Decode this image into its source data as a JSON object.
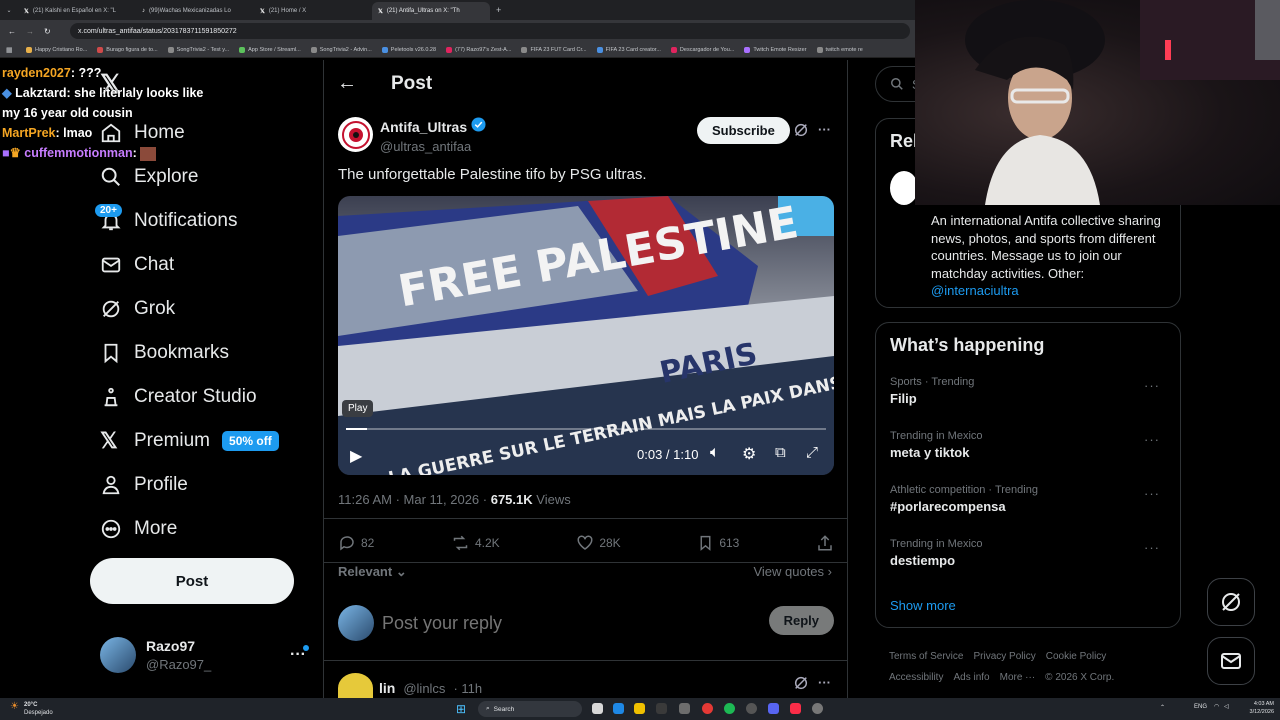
{
  "browser": {
    "tabs": [
      {
        "label": "(21) Kalshi en Español en X: \"L"
      },
      {
        "label": "(99)Wachas Mexicanizadas Lo"
      },
      {
        "label": "(21) Home / X"
      },
      {
        "label": "(21) Antifa_Ultras on X: \"Th"
      }
    ],
    "url": "x.com/ultras_antifaa/status/2031783711591850272",
    "bookmarks": [
      "Happy Cristiano Ro...",
      "Burago figura de to...",
      "SongTrivia2 - Test y...",
      "App Store / Streaml...",
      "SongTrivia2 - Advin...",
      "Peletools v26.0.28",
      "(77) Razo97's Zest-A...",
      "FIFA 23 FUT Card Cr...",
      "FIFA 23 Card creator...",
      "Descargador de You...",
      "Twitch Emote Resizer",
      "twitch emote re"
    ]
  },
  "chat": [
    {
      "user": "rayden2027",
      "msg": ": ???"
    },
    {
      "user": "Lakztard",
      "msg": ": she literlaly looks like my 16 year old cousin"
    },
    {
      "user": "MartPrek",
      "msg": ": lmao"
    },
    {
      "user": "cuffemmotionman",
      "msg": ":"
    }
  ],
  "nav": {
    "items": [
      {
        "label": "Home"
      },
      {
        "label": "Explore"
      },
      {
        "label": "Notifications",
        "badge": "20+"
      },
      {
        "label": "Chat"
      },
      {
        "label": "Grok"
      },
      {
        "label": "Bookmarks"
      },
      {
        "label": "Creator Studio"
      },
      {
        "label": "Premium",
        "promo": "50% off"
      },
      {
        "label": "Profile"
      },
      {
        "label": "More"
      }
    ],
    "post_button": "Post",
    "account": {
      "name": "Razo97",
      "handle": "@Razo97_"
    }
  },
  "post": {
    "header": "Post",
    "author": {
      "name": "Antifa_Ultras",
      "handle": "@ultras_antifaa"
    },
    "subscribe": "Subscribe",
    "text": "The unforgettable Palestine tifo by PSG ultras.",
    "video": {
      "tooltip": "Play",
      "time": "0:03 / 1:10",
      "progress": 0.043,
      "banner_top": "FREE PALESTINE",
      "banner_mid": "LA GUERRE SUR LE TERRAIN MAIS LA PAIX DANS LE MONDE",
      "banner_club": "PARIS"
    },
    "timestamp": "11:26 AM · Mar 11, 2026 · ",
    "views_count": "675.1K",
    "views_label": "Views",
    "stats": {
      "replies": "82",
      "reposts": "4.2K",
      "likes": "28K",
      "bookmarks": "613"
    },
    "sort": "Relevant",
    "view_quotes": "View quotes",
    "reply_placeholder": "Post your reply",
    "reply_button": "Reply",
    "next_reply": {
      "name": "lin",
      "handle": "@linlcs",
      "time": "· 11h"
    }
  },
  "sidebar": {
    "search_placeholder": "Se",
    "relevant_title": "Rel",
    "bio": "An international Antifa collective sharing news, photos, and sports from different countries. Message us to join our matchday activities. Other:",
    "bio_link": "@internaciultra",
    "whats_happening": "What’s happening",
    "trends": [
      {
        "category": "Sports · Trending",
        "title": "Filip"
      },
      {
        "category": "Trending in Mexico",
        "title": "meta y tiktok"
      },
      {
        "category": "Athletic competition · Trending",
        "title": "#porlarecompensa"
      },
      {
        "category": "Trending in Mexico",
        "title": "destiempo"
      }
    ],
    "show_more": "Show more",
    "footer": [
      "Terms of Service",
      "Privacy Policy",
      "Cookie Policy",
      "Accessibility",
      "Ads info",
      "More ···",
      "© 2026 X Corp."
    ]
  },
  "taskbar": {
    "weather_temp": "20°C",
    "weather_desc": "Despejado",
    "search": "Search",
    "lang": "ENG",
    "time": "4:03 AM",
    "date": "3/12/2026"
  },
  "colors": {
    "accent": "#1d9bf0",
    "background": "#000000",
    "border": "#2f3336",
    "muted": "#71767b"
  }
}
